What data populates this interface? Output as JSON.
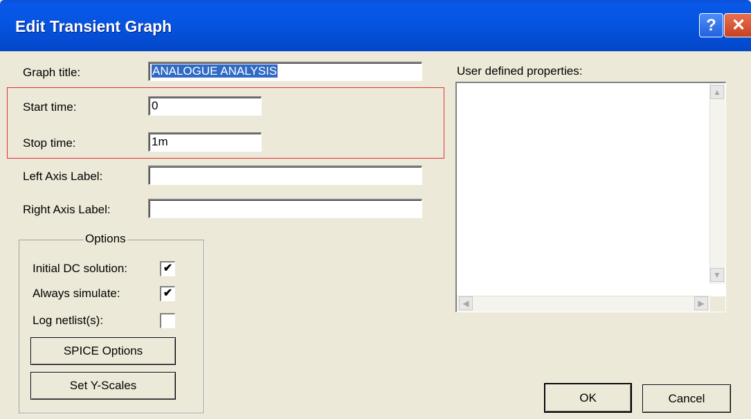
{
  "window": {
    "title": "Edit Transient Graph",
    "help_glyph": "?",
    "close_glyph": "✕"
  },
  "form": {
    "graph_title_label": "Graph title:",
    "graph_title_value": "ANALOGUE ANALYSIS",
    "start_time_label": "Start time:",
    "start_time_value": "0",
    "stop_time_label": "Stop time:",
    "stop_time_value": "1m",
    "left_axis_label": "Left Axis Label:",
    "left_axis_value": "",
    "right_axis_label": "Right Axis Label:",
    "right_axis_value": ""
  },
  "options": {
    "title": "Options",
    "initial_dc_label": "Initial DC solution:",
    "initial_dc_checked": true,
    "always_simulate_label": "Always simulate:",
    "always_simulate_checked": true,
    "log_netlist_label": "Log netlist(s):",
    "log_netlist_checked": false,
    "check_glyph": "✔",
    "spice_options_button": "SPICE Options",
    "set_y_scales_button": "Set Y-Scales"
  },
  "user_props": {
    "label": "User defined properties:"
  },
  "buttons": {
    "ok": "OK",
    "cancel": "Cancel"
  }
}
